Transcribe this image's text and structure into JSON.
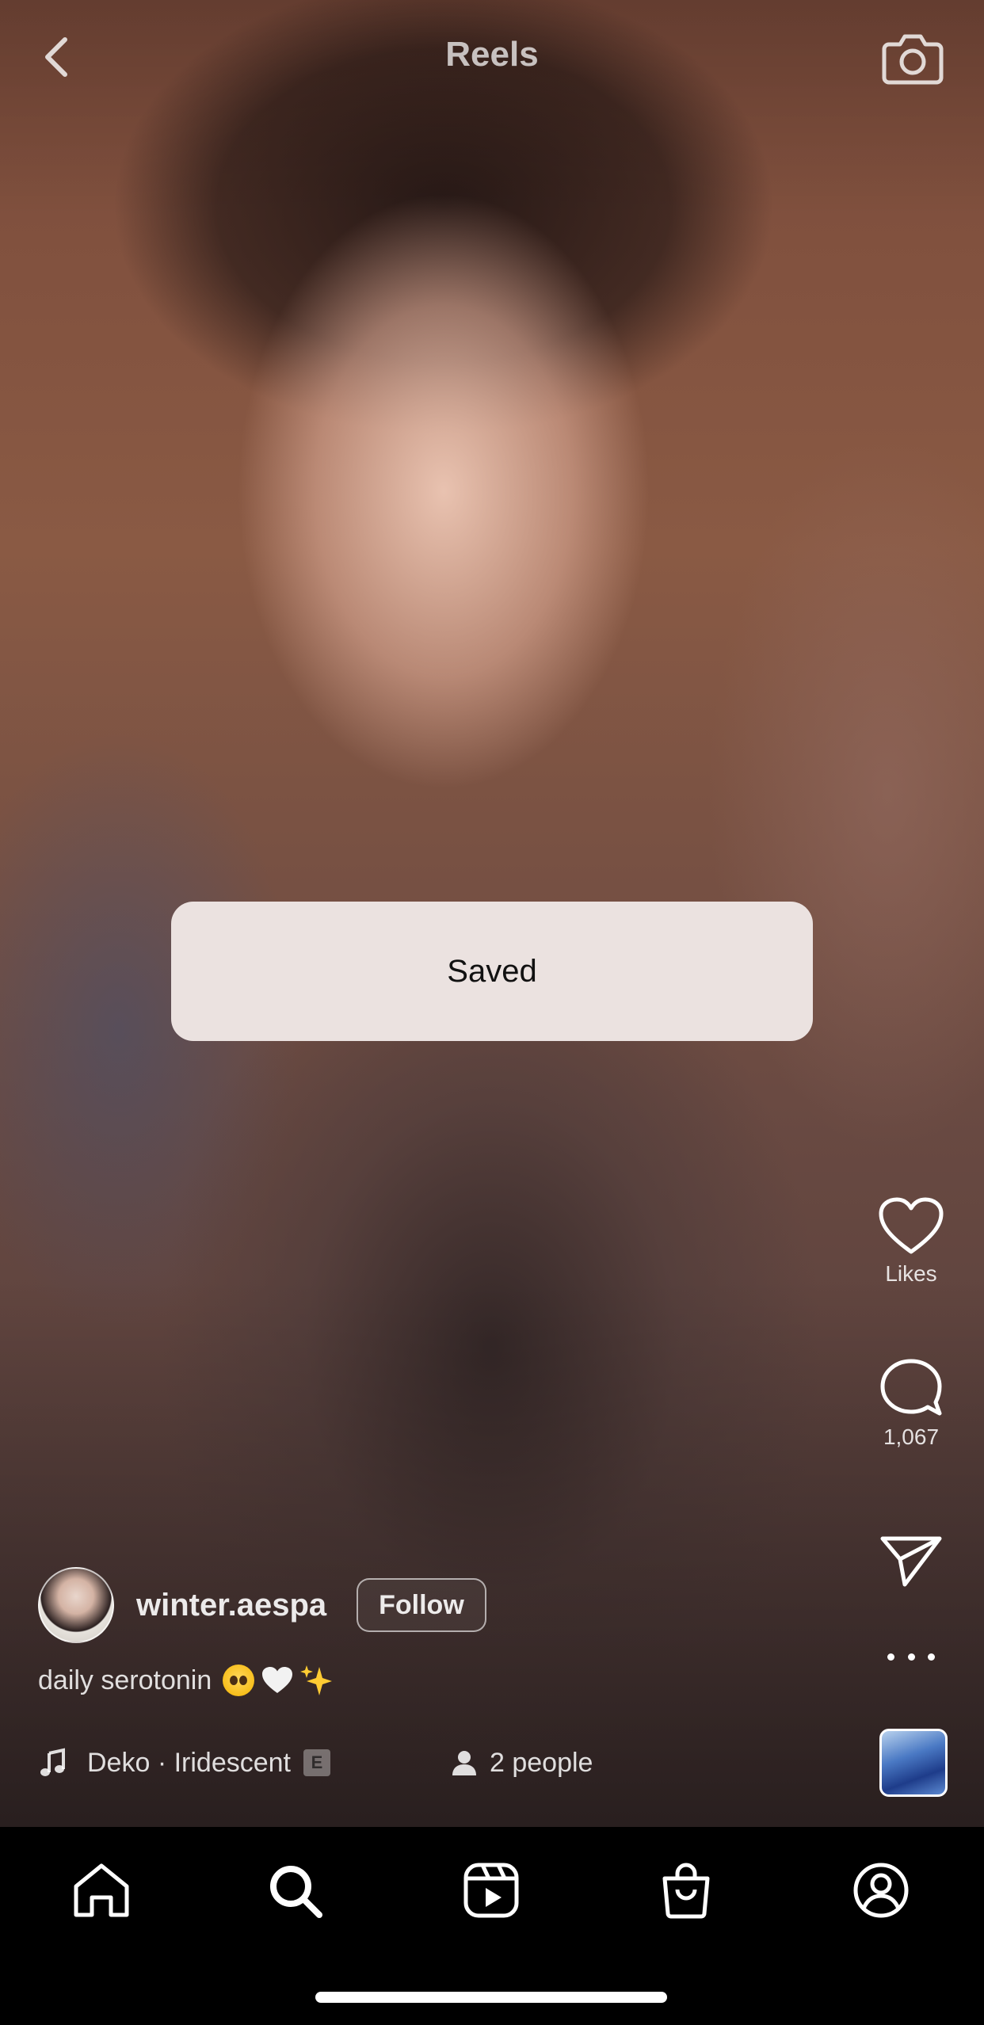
{
  "header": {
    "title": "Reels",
    "back_icon": "chevron-left-icon",
    "camera_icon": "camera-icon"
  },
  "toast": {
    "message": "Saved"
  },
  "actions": {
    "like": {
      "icon": "heart-icon",
      "label": "Likes"
    },
    "comment": {
      "icon": "comment-icon",
      "count": "1,067"
    },
    "share": {
      "icon": "paper-plane-icon"
    },
    "more": {
      "icon": "more-horizontal-icon"
    }
  },
  "post": {
    "username": "winter.aespa",
    "follow_label": "Follow",
    "caption_text": "daily serotonin",
    "caption_emojis": [
      "🥺",
      "🤍",
      "✨"
    ],
    "music": "Deko · Iridescent",
    "explicit_badge": "E",
    "people": "2 people"
  },
  "tabbar": {
    "items": [
      {
        "name": "home",
        "icon": "home-icon"
      },
      {
        "name": "search",
        "icon": "search-icon"
      },
      {
        "name": "reels",
        "icon": "reels-icon"
      },
      {
        "name": "shop",
        "icon": "shopping-bag-icon"
      },
      {
        "name": "profile",
        "icon": "profile-icon"
      }
    ]
  },
  "colors": {
    "toast_bg": "#ebe2e0",
    "tabbar_bg": "#000000",
    "text_on_video": "#ffffff"
  }
}
